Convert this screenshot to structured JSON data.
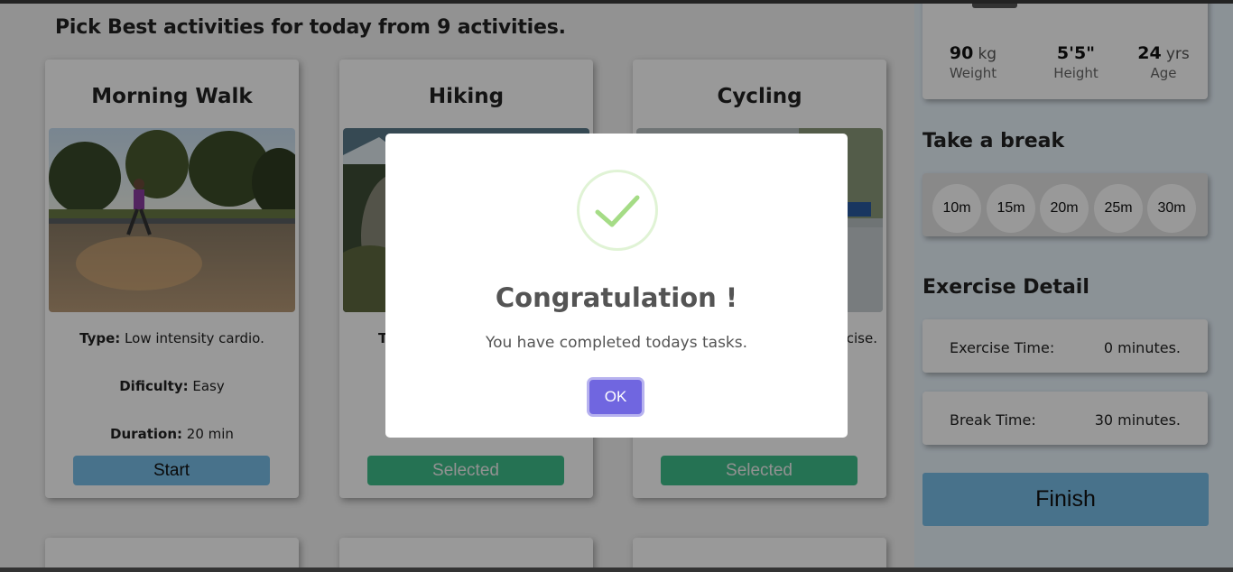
{
  "page": {
    "heading": "Pick Best activities for today from 9 activities."
  },
  "activities": [
    {
      "title": "Morning Walk",
      "type_label": "Type:",
      "type_value": "Low intensity cardio.",
      "difficulty_label": "Dificulty:",
      "difficulty_value": "Easy",
      "duration_label": "Duration:",
      "duration_value": "20 min",
      "button": "Start"
    },
    {
      "title": "Hiking",
      "type_label": "T",
      "button": "Selected"
    },
    {
      "title": "Cycling",
      "type_value_partial": "rcise.",
      "button": "Selected"
    }
  ],
  "profile": {
    "weight_value": "90",
    "weight_unit": "kg",
    "weight_label": "Weight",
    "height_value": "5'5\"",
    "height_label": "Height",
    "age_value": "24",
    "age_unit": "yrs",
    "age_label": "Age"
  },
  "break": {
    "title": "Take a break",
    "options": [
      "10m",
      "15m",
      "20m",
      "25m",
      "30m"
    ]
  },
  "exercise": {
    "title": "Exercise Detail",
    "exercise_time_label": "Exercise Time:",
    "exercise_time_value": "0 minutes.",
    "break_time_label": "Break Time:",
    "break_time_value": "30 minutes."
  },
  "finish_label": "Finish",
  "modal": {
    "title": "Congratulation !",
    "text": "You have completed todays tasks.",
    "ok": "OK"
  },
  "colors": {
    "accent": "#79bee8",
    "selected": "#3fbf8a",
    "ok": "#7066e0",
    "check": "#a5dc86"
  }
}
